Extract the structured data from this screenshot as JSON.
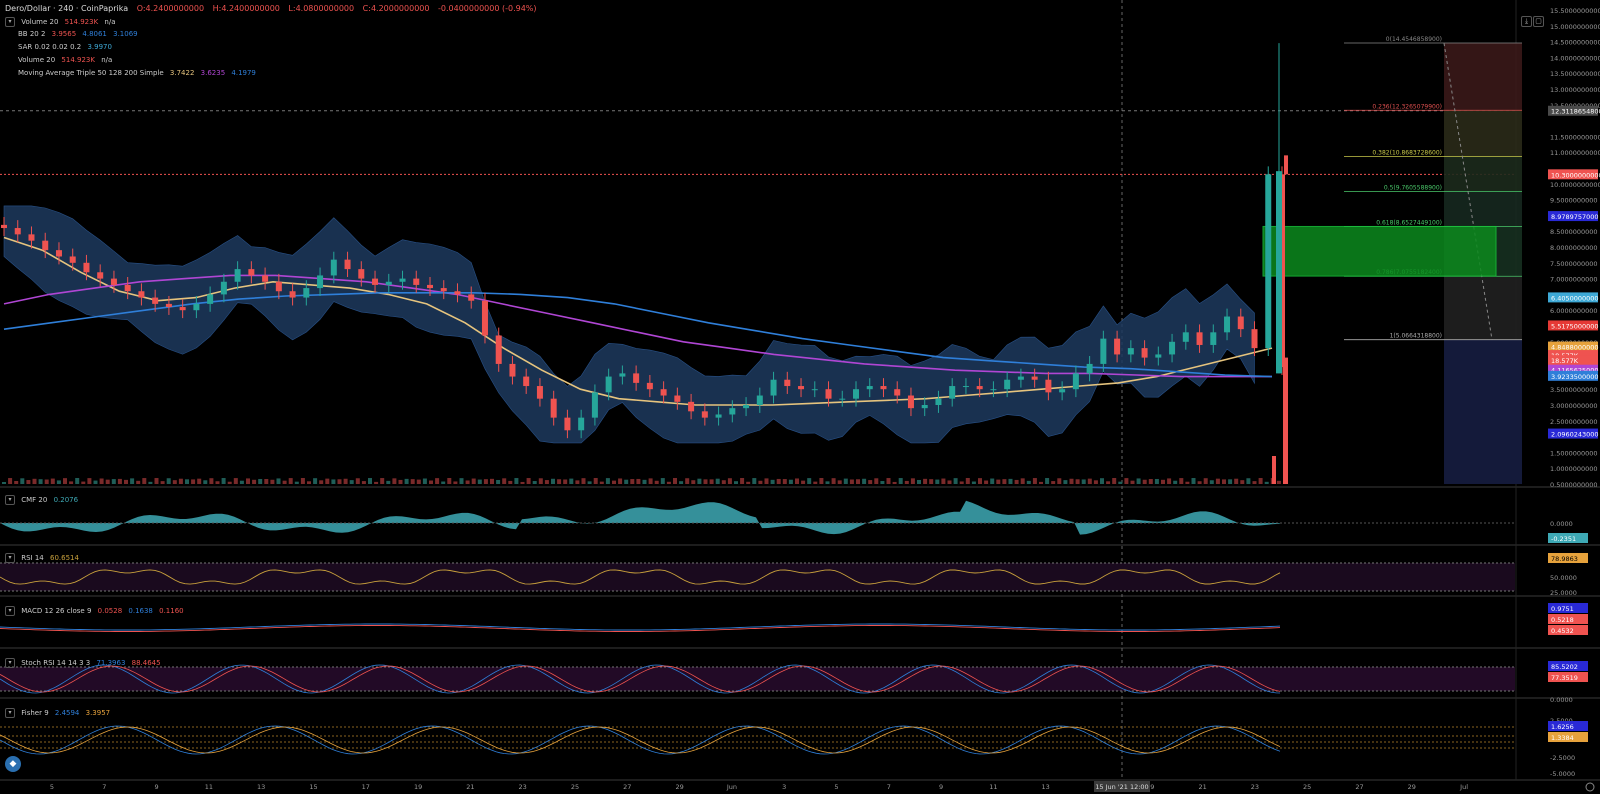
{
  "header": {
    "symbol": "Dero/Dollar · 240 · CoinPaprika",
    "open": "O:4.2400000000",
    "high": "H:4.2400000000",
    "low": "L:4.0800000000",
    "close": "C:4.2000000000",
    "change": "-0.0400000000 (-0.94%)"
  },
  "legends": {
    "volume1": {
      "name": "Volume 20",
      "v1": "514.923K",
      "v2": "n/a"
    },
    "bb": {
      "name": "BB 20 2",
      "v1": "3.9565",
      "v2": "4.8061",
      "v3": "3.1069"
    },
    "sar": {
      "name": "SAR 0.02 0.02 0.2",
      "v1": "3.9970"
    },
    "volume2": {
      "name": "Volume 20",
      "v1": "514.923K",
      "v2": "n/a"
    },
    "mat": {
      "name": "Moving Average Triple 50 128 200 Simple",
      "v1": "3.7422",
      "v2": "3.6235",
      "v3": "4.1979"
    },
    "cmf": {
      "name": "CMF 20",
      "v1": "0.2076"
    },
    "rsi": {
      "name": "RSI 14",
      "v1": "60.6514"
    },
    "macd": {
      "name": "MACD 12 26 close 9",
      "v1": "0.0528",
      "v2": "0.1638",
      "v3": "0.1160"
    },
    "stoch": {
      "name": "Stoch RSI 14 14 3 3",
      "v1": "71.3963",
      "v2": "88.4645"
    },
    "fisher": {
      "name": "Fisher 9",
      "v1": "2.4594",
      "v2": "3.3957"
    }
  },
  "colors": {
    "up": "#26a69a",
    "down": "#ef5350",
    "bb_fill": "#1e3a5f",
    "ma50": "#e6c47e",
    "ma128": "#b046d4",
    "ma200": "#2f7fd9",
    "rsi": "#c8a03c",
    "cmf": "#3ea9b5"
  },
  "fib_levels": [
    {
      "label": "0(14.4546858900)",
      "price": 14.45468589,
      "color": "#888888"
    },
    {
      "label": "0.236(12.3265079900)",
      "price": 12.32650799,
      "color": "#e05050"
    },
    {
      "label": "0.382(10.8683728600)",
      "price": 10.86837286,
      "color": "#c8c84a"
    },
    {
      "label": "0.5(9.7605588900)",
      "price": 9.76055889,
      "color": "#4ac86a"
    },
    {
      "label": "0.618(8.6527449100)",
      "price": 8.65274491,
      "color": "#4ac86a"
    },
    {
      "label": "0.786(7.0755182400)",
      "price": 7.07551824,
      "color": "#4ac86a"
    },
    {
      "label": "1(5.0664318800)",
      "price": 5.06643188,
      "color": "#aaaaaa"
    }
  ],
  "price_axis": {
    "ticks": [
      "15.5000000000",
      "15.0000000000",
      "14.5000000000",
      "14.0000000000",
      "13.5000000000",
      "13.0000000000",
      "12.5000000000",
      "11.5000000000",
      "11.0000000000",
      "10.0000000000",
      "9.5000000000",
      "8.5000000000",
      "8.0000000000",
      "7.5000000000",
      "7.0000000000",
      "6.0000000000",
      "5.0000000000",
      "3.5000000000",
      "3.0000000000",
      "2.5000000000",
      "1.5000000000",
      "1.0000000000",
      "0.5000000000"
    ],
    "tick_values": [
      15.5,
      15.0,
      14.5,
      14.0,
      13.5,
      13.0,
      12.5,
      11.5,
      11.0,
      10.0,
      9.5,
      8.5,
      8.0,
      7.5,
      7.0,
      6.0,
      5.0,
      3.5,
      3.0,
      2.5,
      1.5,
      1.0,
      0.5
    ],
    "badges": [
      {
        "text": "12.3118654800",
        "price": 12.31186548,
        "color": "#4a4a4a"
      },
      {
        "text": "10.3000000000",
        "price": 10.3,
        "color": "#ef5350"
      },
      {
        "text": "8.9789757000",
        "price": 8.9789757,
        "color": "#2929d6"
      },
      {
        "text": "6.4050000000",
        "price": 6.405,
        "color": "#3ea9d6"
      },
      {
        "text": "5.5175000000",
        "price": 5.5175,
        "color": "#e53935"
      },
      {
        "text": "4.8488000000",
        "price": 4.8488,
        "color": "#e6a23c"
      },
      {
        "text": "18.577K",
        "price": 4.58,
        "color": "#ef5350"
      },
      {
        "text": "18.577K",
        "price": 4.42,
        "color": "#ef5350"
      },
      {
        "text": "4.1165625000",
        "price": 4.1165625,
        "color": "#b046d4"
      },
      {
        "text": "3.9233500000",
        "price": 3.92335,
        "color": "#2f7fd9"
      },
      {
        "text": "2.0960243000",
        "price": 2.0960243,
        "color": "#2929d6"
      }
    ]
  },
  "sub_axes": {
    "cmf": {
      "ticks": [
        "0.0000"
      ],
      "badge": "-0.2351"
    },
    "rsi": {
      "ticks": [
        "50.0000",
        "25.0000"
      ],
      "badge": "78.9863"
    },
    "macd": {
      "badges": [
        "0.9751",
        "0.5218",
        "0.4532"
      ]
    },
    "stoch": {
      "ticks": [
        "0.0000"
      ],
      "badges": [
        "85.5202",
        "77.3519"
      ]
    },
    "fisher": {
      "ticks": [
        "2.5000",
        "-2.5000",
        "-5.0000"
      ],
      "badges": [
        "1.6256",
        "1.3384"
      ]
    }
  },
  "time_axis": {
    "labels": [
      "5",
      "7",
      "9",
      "11",
      "13",
      "15",
      "17",
      "19",
      "21",
      "23",
      "25",
      "27",
      "29",
      "Jun",
      "3",
      "5",
      "7",
      "9",
      "11",
      "13",
      "17",
      "19",
      "21",
      "23",
      "25",
      "27",
      "29",
      "Jul"
    ],
    "crosshair": "15 Jun '21  12:00"
  },
  "chart_data": {
    "type": "line",
    "title": "Dero/Dollar · 240 · CoinPaprika",
    "xlabel": "",
    "ylabel": "",
    "ylim": [
      0.5,
      15.5
    ],
    "candles_close": [
      8.6,
      8.4,
      8.2,
      7.9,
      7.7,
      7.5,
      7.2,
      7.0,
      6.8,
      6.6,
      6.4,
      6.2,
      6.1,
      6.0,
      6.2,
      6.5,
      6.9,
      7.3,
      7.1,
      6.9,
      6.6,
      6.4,
      6.7,
      7.1,
      7.6,
      7.3,
      7.0,
      6.8,
      6.9,
      7.0,
      6.8,
      6.7,
      6.6,
      6.5,
      6.3,
      5.2,
      4.3,
      3.9,
      3.6,
      3.2,
      2.6,
      2.2,
      2.6,
      3.4,
      3.9,
      4.0,
      3.7,
      3.5,
      3.3,
      3.1,
      2.8,
      2.6,
      2.7,
      2.9,
      3.0,
      3.3,
      3.8,
      3.6,
      3.5,
      3.5,
      3.2,
      3.2,
      3.5,
      3.6,
      3.5,
      3.3,
      2.9,
      3.0,
      3.2,
      3.6,
      3.6,
      3.5,
      3.5,
      3.8,
      3.9,
      3.8,
      3.4,
      3.5,
      4.0,
      4.3,
      5.1,
      4.6,
      4.8,
      4.5,
      4.6,
      5.0,
      5.3,
      4.9,
      5.3,
      5.8,
      5.4,
      4.8,
      10.3,
      4.2
    ],
    "series": [
      {
        "name": "MA 50",
        "values": [
          8.3,
          7.9,
          7.2,
          6.6,
          6.3,
          6.4,
          6.7,
          6.9,
          6.8,
          6.7,
          6.5,
          6.2,
          5.6,
          4.8,
          4.1,
          3.5,
          3.2,
          3.1,
          3.0,
          3.0,
          3.0,
          3.05,
          3.1,
          3.15,
          3.2,
          3.3,
          3.4,
          3.5,
          3.6,
          3.7,
          3.9,
          4.2,
          4.5,
          4.8
        ]
      },
      {
        "name": "MA 128",
        "values": [
          6.2,
          6.5,
          6.7,
          6.9,
          7.0,
          7.1,
          7.1,
          7.0,
          6.9,
          6.7,
          6.5,
          6.2,
          5.9,
          5.6,
          5.3,
          5.0,
          4.8,
          4.6,
          4.45,
          4.3,
          4.2,
          4.1,
          4.05,
          4.0,
          4.0,
          3.95,
          3.9,
          3.9,
          3.9
        ]
      },
      {
        "name": "MA 200",
        "values": [
          5.4,
          5.6,
          5.8,
          6.0,
          6.2,
          6.35,
          6.45,
          6.5,
          6.55,
          6.55,
          6.55,
          6.5,
          6.4,
          6.2,
          5.9,
          5.6,
          5.35,
          5.1,
          4.9,
          4.7,
          4.5,
          4.4,
          4.3,
          4.2,
          4.15,
          4.05,
          3.95,
          3.9
        ]
      }
    ]
  }
}
